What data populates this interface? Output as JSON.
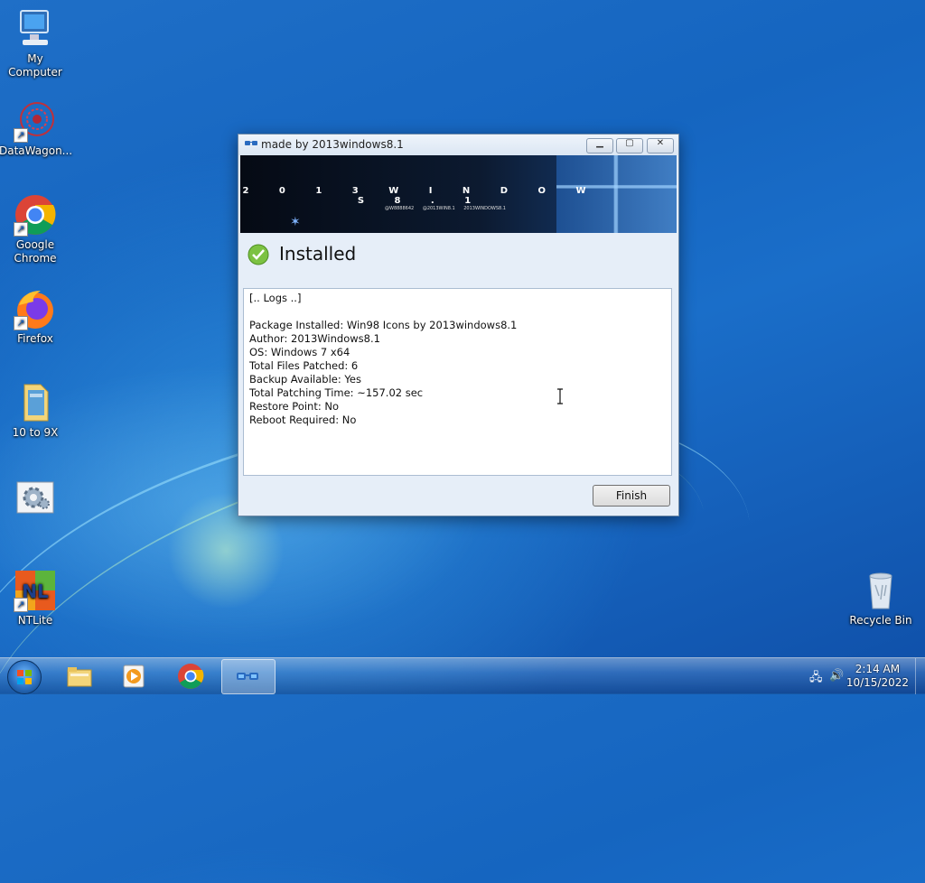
{
  "desktop": {
    "icons": [
      {
        "label": "My Computer"
      },
      {
        "label": "DataWagon..."
      },
      {
        "label": "Google Chrome"
      },
      {
        "label": "Firefox"
      },
      {
        "label": "10 to 9X"
      },
      {
        "label": ""
      },
      {
        "label": "NTLite"
      },
      {
        "label": "Recycle Bin"
      }
    ]
  },
  "window": {
    "title": "made by 2013windows8.1",
    "banner_title": "2 0 1 3 W I N D O W S 8 . 1",
    "banner_handles": [
      "@W8888642",
      "@2013WIN8.1",
      "2013WINDOWS8.1"
    ],
    "status": "Installed",
    "log_lines": [
      "[.. Logs ..]",
      "",
      "Package Installed: Win98 Icons by 2013windows8.1",
      "Author: 2013Windows8.1",
      "OS: Windows 7 x64",
      "Total Files Patched: 6",
      "Backup Available: Yes",
      "Total Patching Time: ~157.02 sec",
      "Restore Point: No",
      "Reboot Required: No"
    ],
    "finish_label": "Finish"
  },
  "taskbar": {
    "pinned": [
      "explorer-icon",
      "media-player-icon",
      "chrome-icon",
      "patcher-icon"
    ],
    "active": "patcher-icon",
    "time": "2:14 AM",
    "date": "10/15/2022"
  }
}
